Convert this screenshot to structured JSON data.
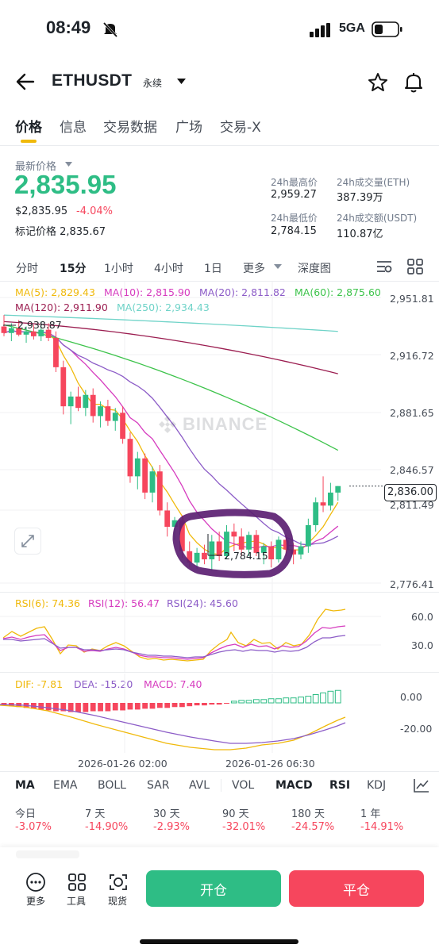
{
  "status_bar": {
    "time": "08:49",
    "network": "5GA"
  },
  "header": {
    "symbol": "ETHUSDT",
    "badge": "永续"
  },
  "tabs": [
    "价格",
    "信息",
    "交易数据",
    "广场",
    "交易-X"
  ],
  "price": {
    "last_label": "最新价格",
    "last": "2,835.95",
    "usd": "$2,835.95",
    "change": "-4.04%",
    "mark": "标记价格 2,835.67"
  },
  "stats": {
    "high_label": "24h最高价",
    "high": "2,959.27",
    "vol_eth_label": "24h成交量(ETH)",
    "vol_eth": "387.39万",
    "low_label": "24h最低价",
    "low": "2,784.15",
    "vol_usdt_label": "24h成交额(USDT)",
    "vol_usdt": "110.87亿"
  },
  "timeframes": [
    "分时",
    "15分",
    "1小时",
    "4小时",
    "1日",
    "更多",
    "深度图"
  ],
  "ma_legend": {
    "ma5": "MA(5): 2,829.43",
    "ma10": "MA(10): 2,815.90",
    "ma20": "MA(20): 2,811.82",
    "ma60": "MA(60): 2,875.60",
    "ma120": "MA(120): 2,911.90",
    "ma250": "MA(250): 2,934.43"
  },
  "colors": {
    "up": "#2ebd85",
    "down": "#f6465d",
    "ma5": "#f0b90b",
    "ma10": "#d63cbf",
    "ma20": "#8c5cc7",
    "ma60": "#3dc34b",
    "ma120": "#9b1d50",
    "ma250": "#6fd3c8"
  },
  "price_axis": [
    "2,951.81",
    "2,916.72",
    "2,881.65",
    "2,846.57",
    "2,811.49",
    "2,776.41"
  ],
  "current_tag": "2,836.00",
  "high_marker": "2,938.87",
  "low_marker": "2,784.15",
  "watermark": "BINANCE",
  "rsi": {
    "rsi6": "RSI(6): 74.36",
    "rsi12": "RSI(12): 56.47",
    "rsi24": "RSI(24): 45.60",
    "axis": [
      "60.0",
      "30.0"
    ]
  },
  "macd": {
    "dif": "DIF: -7.81",
    "dea": "DEA: -15.20",
    "macd": "MACD: 7.40",
    "axis": [
      "0.00",
      "-20.00"
    ]
  },
  "time_axis": [
    "2026-01-26 02:00",
    "2026-01-26 06:30"
  ],
  "indicators": [
    "MA",
    "EMA",
    "BOLL",
    "SAR",
    "AVL",
    "VOL",
    "MACD",
    "RSI",
    "KDJ"
  ],
  "periods": [
    {
      "label": "今日",
      "value": "-3.07%"
    },
    {
      "label": "7 天",
      "value": "-14.90%"
    },
    {
      "label": "30 天",
      "value": "-2.93%"
    },
    {
      "label": "90 天",
      "value": "-32.01%"
    },
    {
      "label": "180 天",
      "value": "-24.57%"
    },
    {
      "label": "1 年",
      "value": "-14.91%"
    }
  ],
  "bottom": {
    "more": "更多",
    "tools": "工具",
    "spot": "现货",
    "open": "开仓",
    "close": "平仓"
  },
  "candles": [
    [
      2934,
      2941,
      2928,
      2930
    ],
    [
      2930,
      2936,
      2925,
      2933
    ],
    [
      2933,
      2938,
      2928,
      2929
    ],
    [
      2929,
      2934,
      2924,
      2931
    ],
    [
      2931,
      2935,
      2926,
      2928
    ],
    [
      2928,
      2937,
      2925,
      2932
    ],
    [
      2932,
      2936,
      2925,
      2927
    ],
    [
      2927,
      2931,
      2906,
      2909
    ],
    [
      2909,
      2913,
      2880,
      2885
    ],
    [
      2885,
      2894,
      2874,
      2891
    ],
    [
      2891,
      2897,
      2882,
      2884
    ],
    [
      2884,
      2895,
      2879,
      2892
    ],
    [
      2892,
      2896,
      2875,
      2879
    ],
    [
      2879,
      2888,
      2872,
      2885
    ],
    [
      2885,
      2889,
      2873,
      2876
    ],
    [
      2876,
      2884,
      2870,
      2881
    ],
    [
      2881,
      2885,
      2862,
      2865
    ],
    [
      2865,
      2869,
      2838,
      2842
    ],
    [
      2842,
      2857,
      2834,
      2853
    ],
    [
      2853,
      2856,
      2828,
      2832
    ],
    [
      2832,
      2848,
      2826,
      2845
    ],
    [
      2845,
      2849,
      2818,
      2821
    ],
    [
      2821,
      2826,
      2805,
      2811
    ],
    [
      2811,
      2817,
      2803,
      2815
    ],
    [
      2815,
      2818,
      2792,
      2796
    ],
    [
      2796,
      2802,
      2786,
      2789
    ],
    [
      2789,
      2798,
      2785,
      2795
    ],
    [
      2795,
      2800,
      2788,
      2791
    ],
    [
      2791,
      2806,
      2784,
      2802
    ],
    [
      2802,
      2808,
      2790,
      2793
    ],
    [
      2793,
      2812,
      2791,
      2808
    ],
    [
      2808,
      2813,
      2796,
      2805
    ],
    [
      2805,
      2810,
      2793,
      2797
    ],
    [
      2797,
      2808,
      2793,
      2806
    ],
    [
      2806,
      2809,
      2793,
      2795
    ],
    [
      2795,
      2801,
      2788,
      2799
    ],
    [
      2799,
      2802,
      2786,
      2791
    ],
    [
      2791,
      2805,
      2789,
      2803
    ],
    [
      2803,
      2806,
      2793,
      2797
    ],
    [
      2797,
      2801,
      2788,
      2794
    ],
    [
      2794,
      2802,
      2791,
      2799
    ],
    [
      2799,
      2816,
      2795,
      2812
    ],
    [
      2812,
      2829,
      2808,
      2826
    ],
    [
      2826,
      2842,
      2820,
      2824
    ],
    [
      2824,
      2838,
      2821,
      2832
    ],
    [
      2832,
      2836,
      2827,
      2836
    ]
  ]
}
